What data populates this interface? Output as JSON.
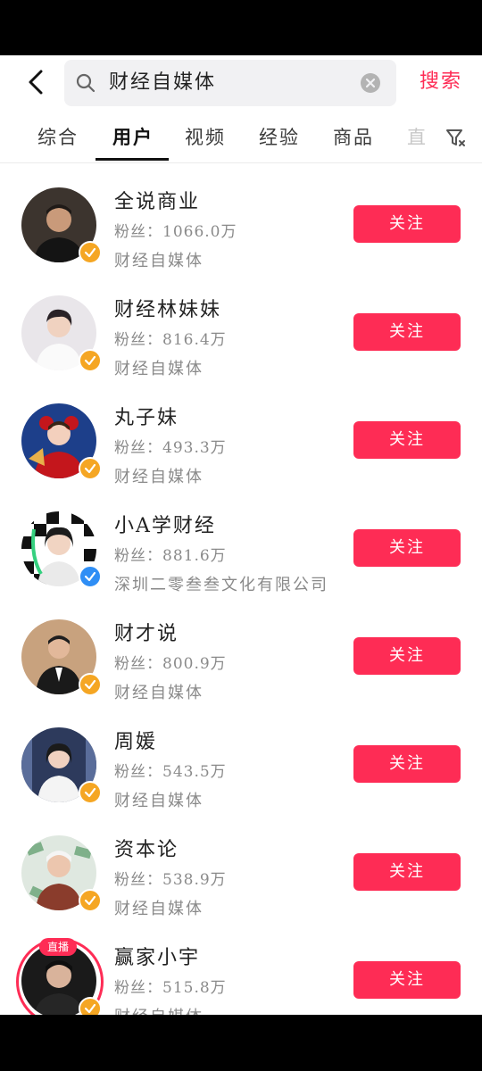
{
  "search": {
    "query": "财经自媒体",
    "button": "搜索"
  },
  "tabs": [
    {
      "label": "综合",
      "active": false
    },
    {
      "label": "用户",
      "active": true
    },
    {
      "label": "视频",
      "active": false
    },
    {
      "label": "经验",
      "active": false
    },
    {
      "label": "商品",
      "active": false
    },
    {
      "label": "直",
      "active": false
    }
  ],
  "colors": {
    "accent": "#fe2c55",
    "verified_gold": "#f5a623",
    "verified_blue": "#2f8ef5"
  },
  "users": [
    {
      "name": "全说商业",
      "fans": "粉丝：1066.0万",
      "desc": "财经自媒体",
      "follow": "关注",
      "badge": "gold"
    },
    {
      "name": "财经林妹妹",
      "fans": "粉丝：816.4万",
      "desc": "财经自媒体",
      "follow": "关注",
      "badge": "gold"
    },
    {
      "name": "丸子妹",
      "fans": "粉丝：493.3万",
      "desc": "财经自媒体",
      "follow": "关注",
      "badge": "gold"
    },
    {
      "name": "小A学财经",
      "fans": "粉丝：881.6万",
      "desc": "深圳二零叁叁文化有限公司",
      "follow": "关注",
      "badge": "blue"
    },
    {
      "name": "财才说",
      "fans": "粉丝：800.9万",
      "desc": "财经自媒体",
      "follow": "关注",
      "badge": "gold"
    },
    {
      "name": "周媛",
      "fans": "粉丝：543.5万",
      "desc": "财经自媒体",
      "follow": "关注",
      "badge": "gold"
    },
    {
      "name": "资本论",
      "fans": "粉丝：538.9万",
      "desc": "财经自媒体",
      "follow": "关注",
      "badge": "gold"
    },
    {
      "name": "赢家小宇",
      "fans": "粉丝：515.8万",
      "desc": "财经自媒体",
      "follow": "关注",
      "badge": "gold",
      "live": "直播"
    }
  ]
}
